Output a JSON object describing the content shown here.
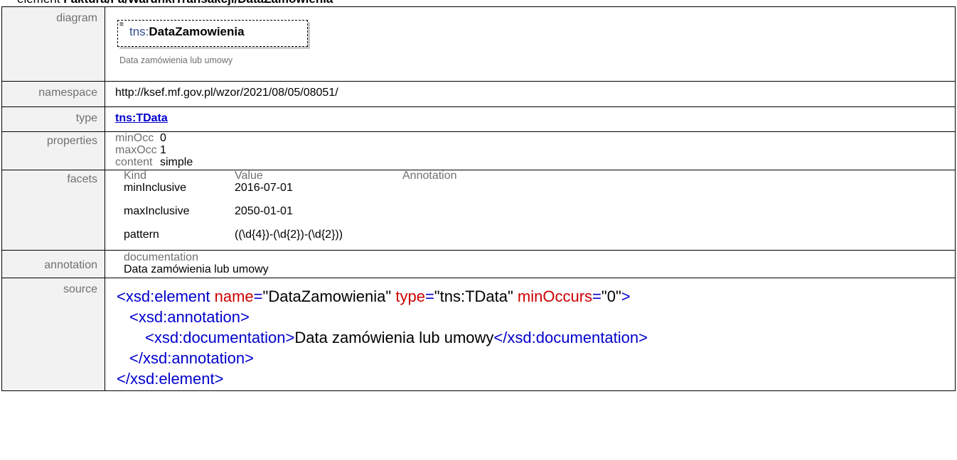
{
  "heading": {
    "prefix": "element",
    "path": "Faktura/Fa/WarunkiTransakcji/DataZamowienia"
  },
  "rows": {
    "diagram": {
      "label": "diagram",
      "element_ns": "tns:",
      "element_name": "DataZamowienia",
      "caption": "Data zamówienia lub umowy"
    },
    "namespace": {
      "label": "namespace",
      "value": "http://ksef.mf.gov.pl/wzor/2021/08/05/08051/"
    },
    "type": {
      "label": "type",
      "value": "tns:TData"
    },
    "properties": {
      "label": "properties",
      "items": [
        {
          "key": "minOcc",
          "value": "0"
        },
        {
          "key": "maxOcc",
          "value": "1"
        },
        {
          "key": "content",
          "value": "simple"
        }
      ]
    },
    "facets": {
      "label": "facets",
      "headers": [
        "Kind",
        "Value",
        "Annotation"
      ],
      "items": [
        {
          "kind": "minInclusive",
          "value": "2016-07-01",
          "annotation": ""
        },
        {
          "kind": "maxInclusive",
          "value": "2050-01-01",
          "annotation": ""
        },
        {
          "kind": "pattern",
          "value": "((\\d{4})-(\\d{2})-(\\d{2}))",
          "annotation": ""
        }
      ]
    },
    "annotation": {
      "label": "annotation",
      "key": "documentation",
      "value": "Data zamówienia lub umowy"
    },
    "source": {
      "label": "source",
      "tag_element": "xsd:element",
      "attr_name": "name",
      "attr_name_value": "\"DataZamowienia\"",
      "attr_type": "type",
      "attr_type_value": "\"tns:TData\"",
      "attr_minoccurs": "minOccurs",
      "attr_minoccurs_value": "\"0\"",
      "tag_annotation": "xsd:annotation",
      "tag_documentation": "xsd:documentation",
      "doc_text": "Data zamówienia lub umowy"
    }
  },
  "colors": {
    "label_bg": "#f2f2f2",
    "label_text": "#707070",
    "tag_blue": "#0000cc",
    "attr_red": "#cc0000",
    "link": "#0000cc"
  }
}
